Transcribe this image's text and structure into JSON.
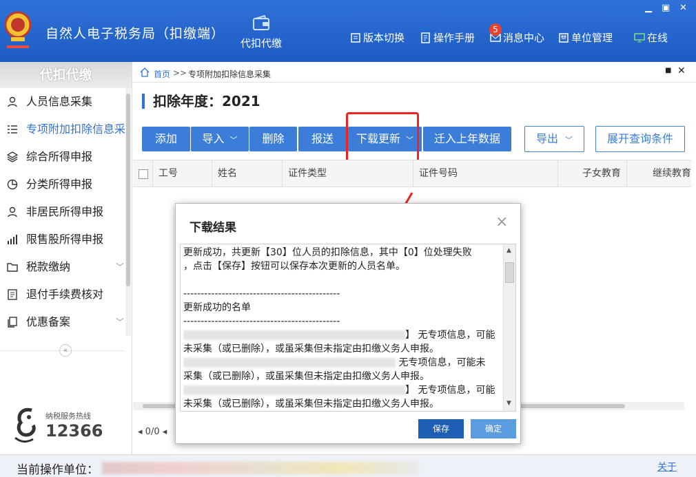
{
  "header": {
    "app_title": "自然人电子税务局（扣缴端）",
    "module_label": "代扣代缴",
    "nav": [
      {
        "label": "版本切换",
        "icon": "version-icon"
      },
      {
        "label": "操作手册",
        "icon": "manual-icon"
      },
      {
        "label": "消息中心",
        "icon": "mail-icon",
        "badge": "5"
      },
      {
        "label": "单位管理",
        "icon": "unit-icon"
      },
      {
        "label": "在线",
        "icon": "online-icon"
      }
    ]
  },
  "sidebar": {
    "title": "代扣代缴",
    "items": [
      {
        "label": "人员信息采集",
        "icon": "person-icon"
      },
      {
        "label": "专项附加扣除信息采集",
        "icon": "list-icon"
      },
      {
        "label": "综合所得申报",
        "icon": "layers-icon"
      },
      {
        "label": "分类所得申报",
        "icon": "pie-icon"
      },
      {
        "label": "非居民所得申报",
        "icon": "person-icon"
      },
      {
        "label": "限售股所得申报",
        "icon": "bar-icon"
      },
      {
        "label": "税款缴纳",
        "icon": "folder-icon"
      },
      {
        "label": "退付手续费核对",
        "icon": "doc-icon"
      },
      {
        "label": "优惠备案",
        "icon": "copy-icon"
      }
    ],
    "hotline_label": "纳税服务热线",
    "hotline_number": "12366"
  },
  "breadcrumb": {
    "home": "首页",
    "separator": ">>",
    "current": "专项附加扣除信息采集"
  },
  "year_label": "扣除年度：2021",
  "toolbar": {
    "add": "添加",
    "import": "导入",
    "delete": "删除",
    "submit": "报送",
    "download_update": "下载更新",
    "migrate": "迁入上年数据",
    "export": "导出",
    "expand_query": "展开查询条件"
  },
  "table": {
    "columns": [
      "工号",
      "姓名",
      "证件类型",
      "证件号码",
      "子女教育",
      "继续教育"
    ]
  },
  "pager": {
    "text": "0/0"
  },
  "status_bar": {
    "label": "当前操作单位：",
    "about": "关于"
  },
  "dialog": {
    "title": "下载结果",
    "lines": [
      "更新成功，共更新【30】位人员的扣除信息，其中【0】位处理失败",
      "，点击【保存】按钮可以保存本次更新的人员名单。",
      "",
      "---------------------------------------------",
      "更新成功的名单",
      "---------------------------------------------"
    ],
    "entry_suffix_1": "】 无专项信息，可能",
    "entry_line_2": "未采集（或已删除），或虽采集但未指定由扣缴义务人申报。",
    "entry_suffix_2": " 无专项信息，可能未",
    "entry_line_4": "采集（或已删除），或虽采集但未指定由扣缴义务人申报。",
    "entry_suffix_3": "】 无专项信息，可能",
    "entry_line_6": "未采集（或已删除），或虽采集但未指定由扣缴义务人申报。",
    "save_button": "保存",
    "ok_button": "确定"
  },
  "colors": {
    "header_blue": "#2f72d8",
    "toolbar_blue": "#3b7dd8",
    "highlight_red": "#e22222",
    "badge_red": "#e8412c"
  }
}
